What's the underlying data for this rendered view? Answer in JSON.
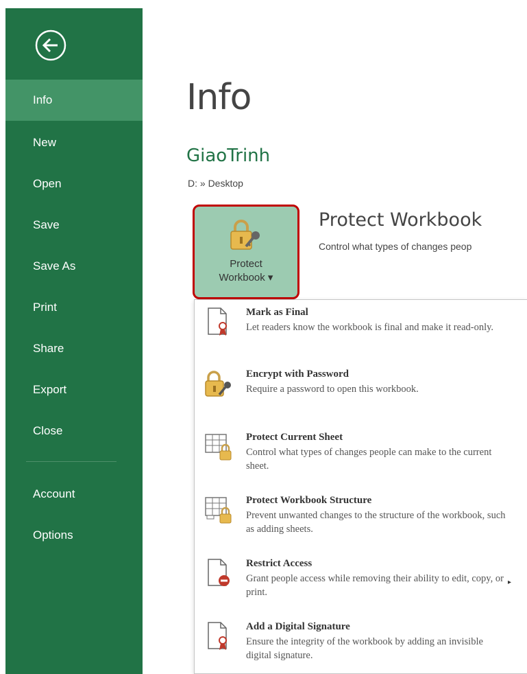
{
  "sidebar": {
    "back_icon": "back-arrow-circle-icon",
    "items": [
      {
        "label": "Info"
      },
      {
        "label": "New"
      },
      {
        "label": "Open"
      },
      {
        "label": "Save"
      },
      {
        "label": "Save As"
      },
      {
        "label": "Print"
      },
      {
        "label": "Share"
      },
      {
        "label": "Export"
      },
      {
        "label": "Close"
      },
      {
        "label": "Account"
      },
      {
        "label": "Options"
      }
    ]
  },
  "main": {
    "title": "Info",
    "document_name": "GiaoTrinh",
    "document_path": "D: » Desktop",
    "protect_button": {
      "line1": "Protect",
      "line2": "Workbook ▾"
    },
    "section_title": "Protect Workbook",
    "section_desc": "Control what types of changes peop"
  },
  "menu": {
    "items": [
      {
        "title": "Mark as Final",
        "desc": "Let readers know the workbook is final and make it read-only.",
        "icon": "document-ribbon-icon"
      },
      {
        "title": "Encrypt with Password",
        "desc": "Require a password to open this workbook.",
        "icon": "lock-key-icon"
      },
      {
        "title": "Protect Current Sheet",
        "desc": "Control what types of changes people can make to the current sheet.",
        "icon": "sheet-lock-icon"
      },
      {
        "title": "Protect Workbook Structure",
        "desc": "Prevent unwanted changes to the structure of the workbook, such as adding sheets.",
        "icon": "workbook-lock-icon"
      },
      {
        "title": "Restrict Access",
        "desc": "Grant people access while removing their ability to edit, copy, or print.",
        "icon": "document-restrict-icon"
      },
      {
        "title": "Add a Digital Signature",
        "desc": "Ensure the integrity of the workbook by adding an invisible digital signature.",
        "icon": "document-signature-icon"
      }
    ],
    "submenu_arrow": "▸"
  },
  "colors": {
    "sidebar": "#217346",
    "sidebar_active": "#439467",
    "accent_text": "#217346",
    "button_bg": "#9ccbb1",
    "highlight_border": "#c00000"
  }
}
